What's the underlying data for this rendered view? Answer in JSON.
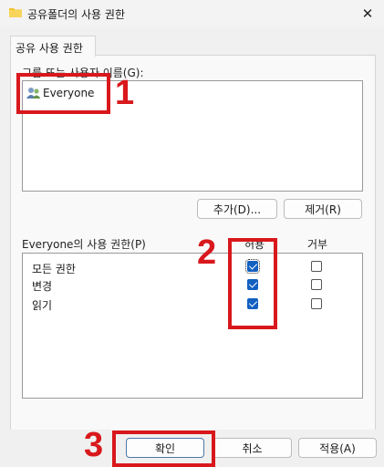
{
  "window": {
    "title": "공유폴더의 사용 권한",
    "close_glyph": "✕"
  },
  "tab": {
    "label": "공유 사용 권한"
  },
  "group_section": {
    "label": "그룹 또는 사용자 이름(G):",
    "users": [
      {
        "name": "Everyone",
        "icon": "users-icon",
        "selected": true
      }
    ]
  },
  "buttons": {
    "add": "추가(D)...",
    "remove": "제거(R)"
  },
  "perm_section": {
    "label": "Everyone의 사용 권한(P)",
    "col_allow": "허용",
    "col_deny": "거부",
    "rows": [
      {
        "label": "모든 권한",
        "allow": true,
        "deny": false
      },
      {
        "label": "변경",
        "allow": true,
        "deny": false
      },
      {
        "label": "읽기",
        "allow": true,
        "deny": false
      }
    ]
  },
  "footer": {
    "ok": "확인",
    "cancel": "취소",
    "apply": "적용(A)"
  },
  "annotations": {
    "mark1": "1",
    "mark2": "2",
    "mark3": "3",
    "color": "#d8181c"
  }
}
